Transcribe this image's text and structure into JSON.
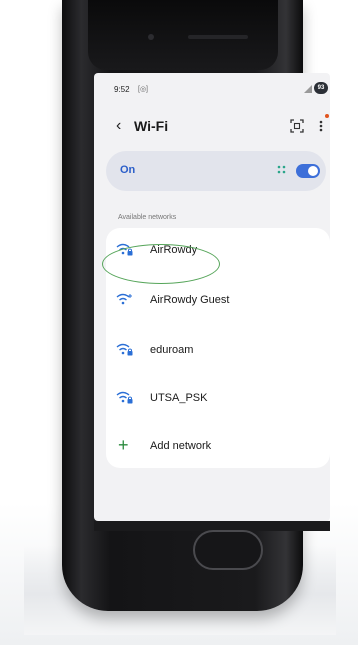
{
  "status_bar": {
    "time": "9:52",
    "small_icon": "[◎]",
    "battery": "93"
  },
  "header": {
    "title": "Wi-Fi"
  },
  "wifi_toggle": {
    "label": "On",
    "state": "on"
  },
  "networks": {
    "section_label": "Available networks",
    "items": [
      {
        "name": "AirRowdy",
        "icon": "wifi-lock-icon"
      },
      {
        "name": "AirRowdy Guest",
        "icon": "wifi-icon"
      },
      {
        "name": "eduroam",
        "icon": "wifi-lock-icon"
      },
      {
        "name": "UTSA_PSK",
        "icon": "wifi-lock-icon"
      }
    ],
    "add_label": "Add network"
  },
  "colors": {
    "accent": "#3d6fd9",
    "highlight": "#56a55a",
    "notification": "#e0541f"
  }
}
